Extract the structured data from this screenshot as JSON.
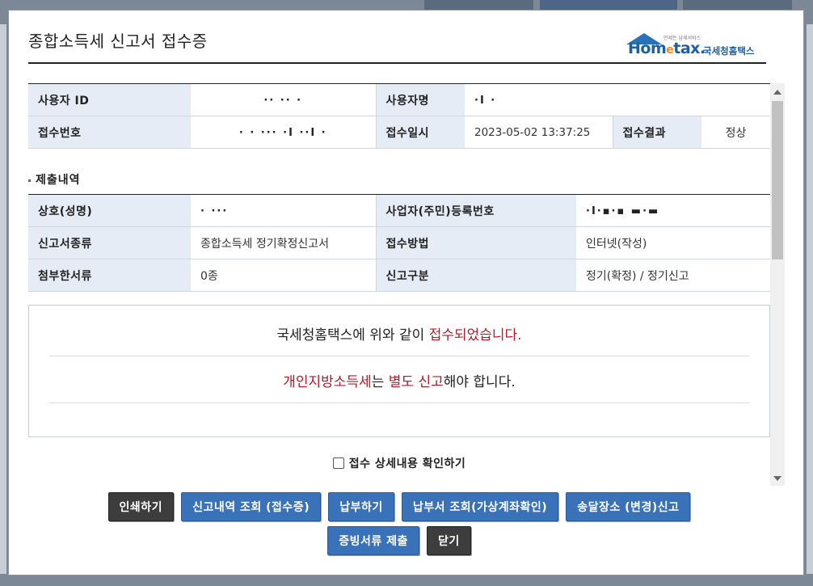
{
  "dialog": {
    "title": "종합소득세 신고서 접수증",
    "logo": {
      "brand_pre": "Hom",
      "brand_e": "e",
      "brand_post": "tax.",
      "korean": "국세청홈택스",
      "tagline": "언제든 납세서비스"
    }
  },
  "receipt_info": {
    "user_id": {
      "label": "사용자 ID",
      "value": "·· ·· ·"
    },
    "user_name": {
      "label": "사용자명",
      "value": "·I ·"
    },
    "receipt_no": {
      "label": "접수번호",
      "value": "· · ··· ·I ··I ·"
    },
    "receipt_datetime": {
      "label": "접수일시",
      "value": "2023-05-02 13:37:25"
    },
    "receipt_result": {
      "label": "접수결과",
      "value": "정상"
    }
  },
  "submission": {
    "section_title": "제출내역",
    "company_name": {
      "label": "상호(성명)",
      "value": "· ···"
    },
    "business_reg_no": {
      "label": "사업자(주민)등록번호",
      "value": "·I·▪·▪ ▬·▬"
    },
    "report_type": {
      "label": "신고서종류",
      "value": "종합소득세 정기확정신고서"
    },
    "receipt_method": {
      "label": "접수방법",
      "value": "인터넷(작성)"
    },
    "attachments": {
      "label": "첨부한서류",
      "value": "0종"
    },
    "report_category": {
      "label": "신고구분",
      "value": "정기(확정) / 정기신고"
    }
  },
  "notice": {
    "line1_prefix": "국세청홈택스에 위와 같이 ",
    "line1_highlight": "접수되었습니다.",
    "line2_part1": "개인지방소득세",
    "line2_part2": "는 ",
    "line2_part3": "별도 신고",
    "line2_part4": "해야 합니다."
  },
  "confirm_checkbox": {
    "label": "접수 상세내용 확인하기",
    "checked": false
  },
  "buttons": {
    "print": "인쇄하기",
    "view_report": "신고내역 조회 (접수증)",
    "pay": "납부하기",
    "view_bill": "납부서 조회(가상계좌확인)",
    "delivery": "송달장소 (변경)신고",
    "submit_docs": "증빙서류 제출",
    "close": "닫기"
  },
  "colors": {
    "accent_red": "#b01c2e",
    "button_blue": "#3a72b9",
    "button_dark": "#3d3d3d",
    "label_bg": "#e6ecf5"
  }
}
